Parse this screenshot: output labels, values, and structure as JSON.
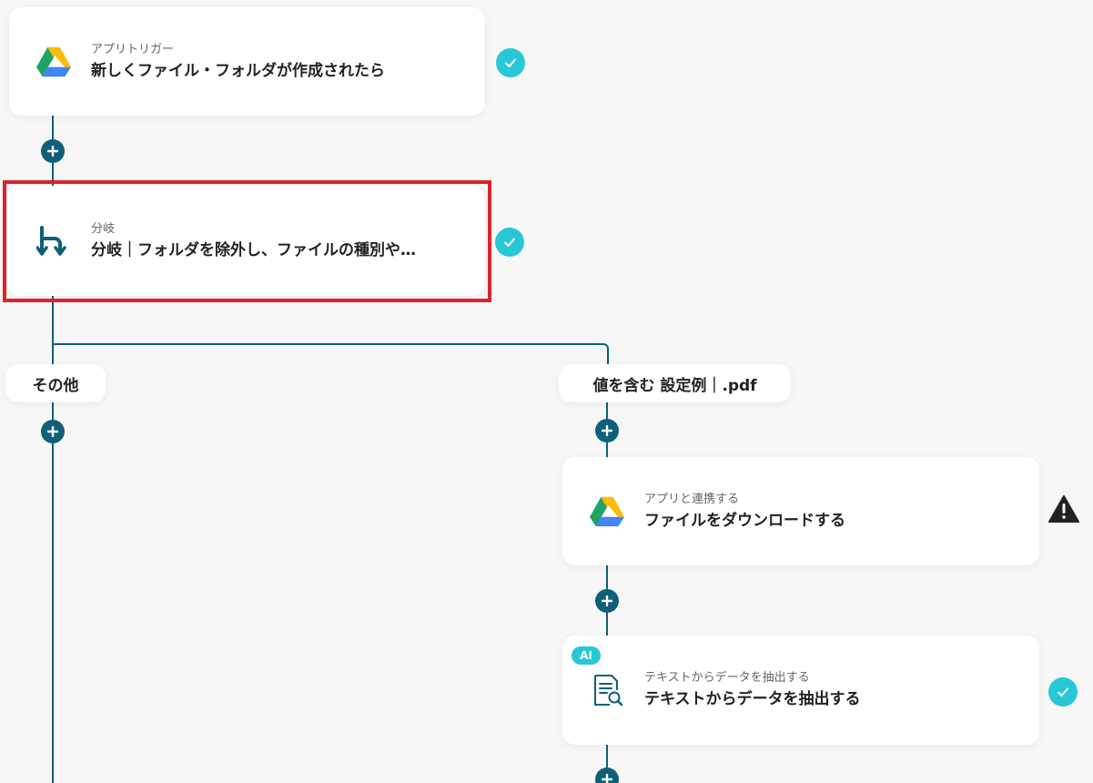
{
  "steps": {
    "trigger": {
      "sub": "アプリトリガー",
      "title": "新しくファイル・フォルダが作成されたら",
      "icon": "google-drive-icon"
    },
    "branch": {
      "sub": "分岐",
      "title": "分岐｜フォルダを除外し、ファイルの種別や…",
      "icon": "branch-icon"
    },
    "download": {
      "sub": "アプリと連携する",
      "title": "ファイルをダウンロードする",
      "icon": "google-drive-icon"
    },
    "extract": {
      "sub": "テキストからデータを抽出する",
      "title": "テキストからデータを抽出する",
      "icon": "document-search-icon",
      "badge": "AI"
    }
  },
  "branches": {
    "left_label": "その他",
    "right_label": "値を含む 設定例｜.pdf"
  },
  "colors": {
    "line": "#0f5f79",
    "check": "#28c7d6",
    "highlight": "#e0202a",
    "warning": "#222222"
  }
}
